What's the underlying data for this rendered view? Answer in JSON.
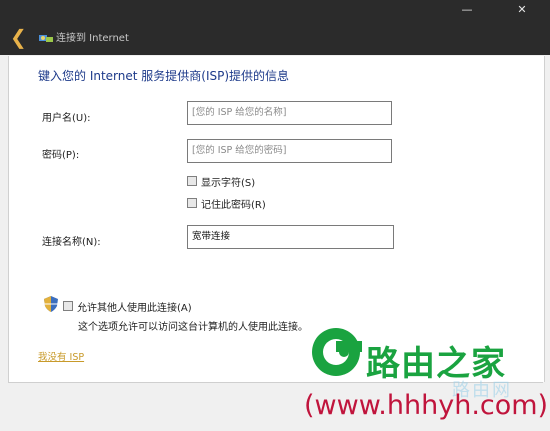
{
  "window": {
    "minimize_glyph": "—",
    "close_glyph": "✕",
    "back_glyph": "❮",
    "title": "连接到 Internet"
  },
  "form": {
    "heading": "键入您的 Internet 服务提供商(ISP)提供的信息",
    "username_label": "用户名(U):",
    "username_placeholder": "[您的 ISP 给您的名称]",
    "password_label": "密码(P):",
    "password_placeholder": "[您的 ISP 给您的密码]",
    "show_chars_label": "显示字符(S)",
    "remember_label": "记住此密码(R)",
    "connection_name_label": "连接名称(N):",
    "connection_name_value": "宽带连接",
    "allow_others_label": "允许其他人使用此连接(A)",
    "allow_others_note": "这个选项允许可以访问这台计算机的人使用此连接。",
    "no_isp_link": "我没有 ISP"
  },
  "watermark": {
    "brand": "路由之家",
    "faint": "路由网",
    "url": "(www.hhhyh.com)"
  },
  "colors": {
    "titlebar": "#2b2b2b",
    "accent_link": "#c89a2a",
    "heading": "#1d3a8a",
    "brand_green": "#1aa340",
    "url_red": "#c0143c"
  }
}
